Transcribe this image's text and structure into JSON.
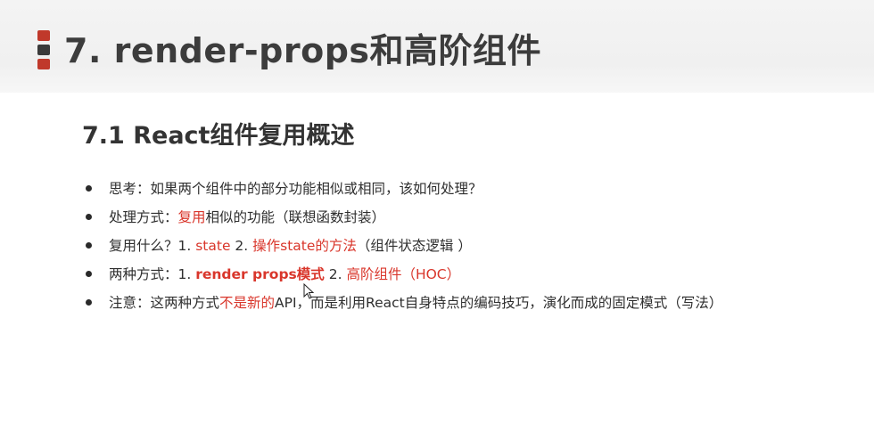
{
  "slide": {
    "title": "7. render-props和高阶组件",
    "section_title": "7.1 React组件复用概述",
    "bullets": [
      {
        "parts": [
          "思考：如果两个组件中的部分功能相似或相同，该如何处理？"
        ]
      },
      {
        "parts": [
          "处理方式：",
          "复用",
          "相似的功能（联想函数封装）"
        ]
      },
      {
        "parts": [
          "复用什么？1. ",
          "state",
          " 2. ",
          "操作state的方法",
          "（组件状态逻辑 ）"
        ]
      },
      {
        "parts": [
          "两种方式：1. ",
          "render props模式",
          " 2. ",
          "高阶组件（HOC）"
        ]
      },
      {
        "parts": [
          "注意：这两种方式",
          "不是新的",
          "API，而是利用React自身特点的编码技巧，演化而成的固定模式（写法）"
        ]
      }
    ]
  },
  "colors": {
    "accent_red": "#d9362b",
    "title_text": "#3c3c3c",
    "title_band": "#f0f0f0"
  }
}
